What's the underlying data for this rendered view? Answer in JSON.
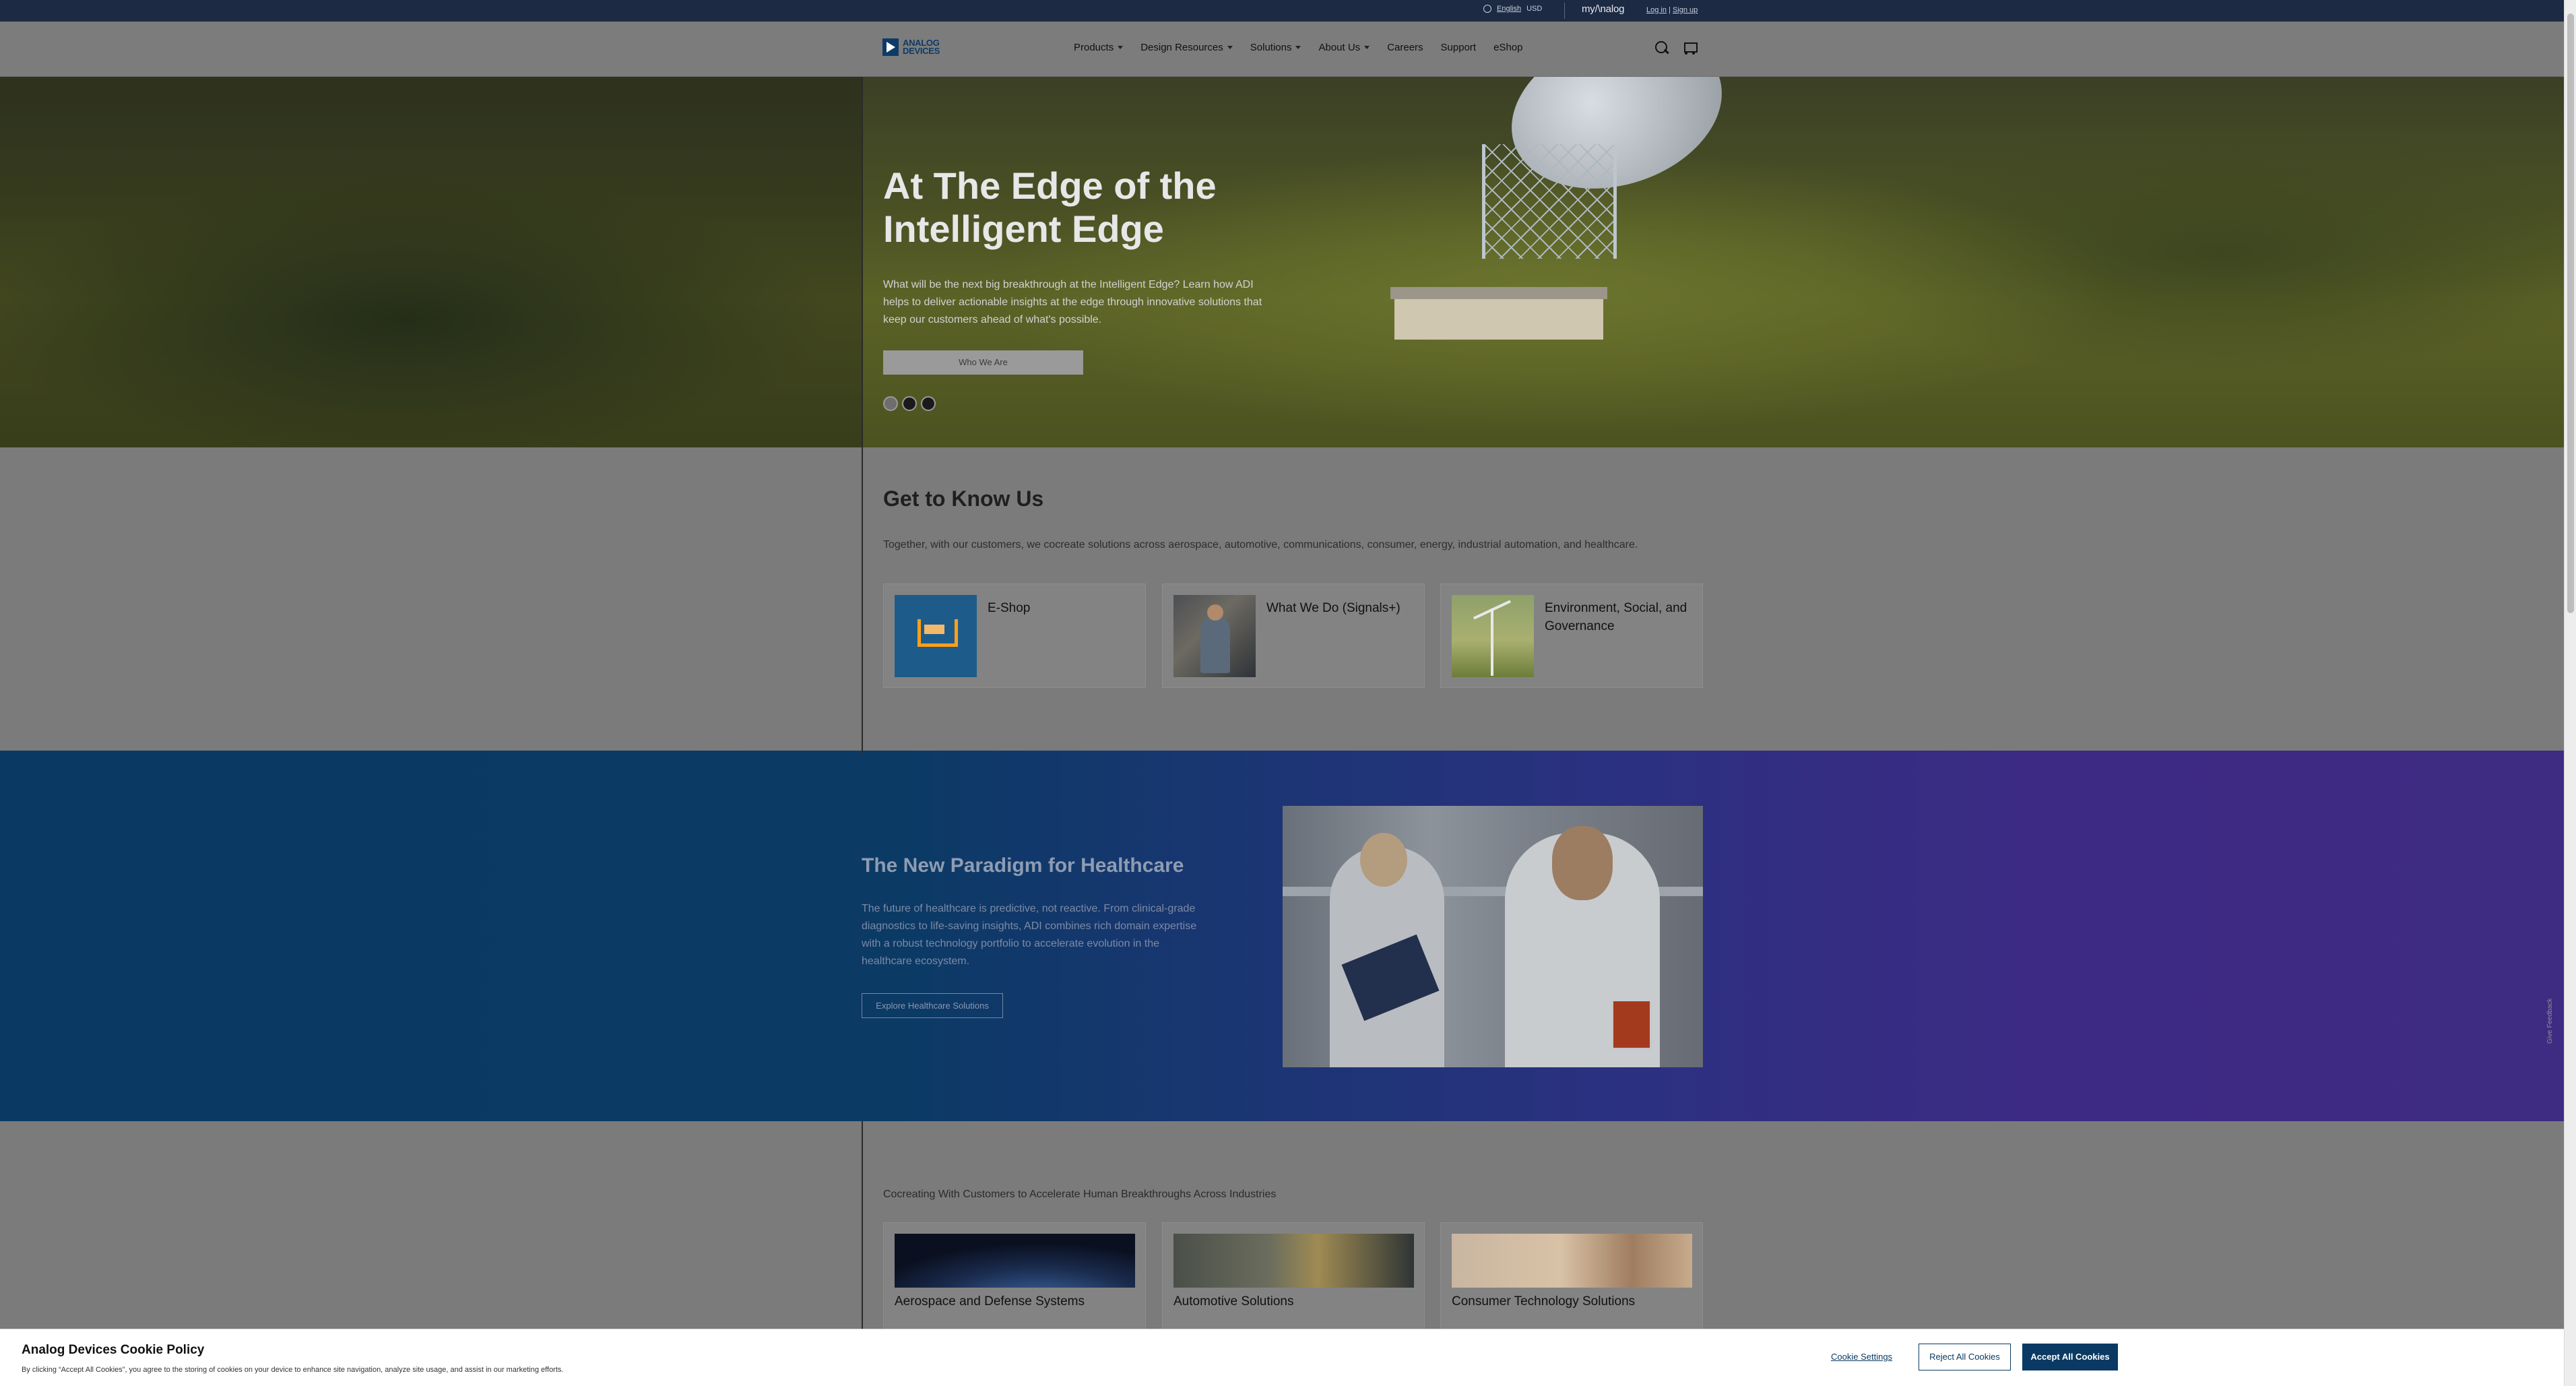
{
  "utility": {
    "language": "English",
    "currency": "USD",
    "myanalog": "my/\\nalog",
    "login": "Log in",
    "separator": "|",
    "signup": "Sign up"
  },
  "nav": {
    "logo_text": "ANALOG DEVICES",
    "items": [
      {
        "label": "Products",
        "dropdown": true
      },
      {
        "label": "Design Resources",
        "dropdown": true
      },
      {
        "label": "Solutions",
        "dropdown": true
      },
      {
        "label": "About Us",
        "dropdown": true
      },
      {
        "label": "Careers",
        "dropdown": false
      },
      {
        "label": "Support",
        "dropdown": false
      },
      {
        "label": "eShop",
        "dropdown": false
      }
    ],
    "icons": [
      "search-icon",
      "cart-icon"
    ]
  },
  "hero": {
    "title": "At The Edge of the Intelligent Edge",
    "description": "What will be the next big breakthrough at the Intelligent Edge? Learn how ADI helps to deliver actionable insights at the edge through innovative solutions that keep our customers ahead of what's possible.",
    "button": "Who We Are",
    "slides": 3,
    "active_slide": 1
  },
  "know_us": {
    "title": "Get to Know Us",
    "description": "Together, with our customers, we cocreate solutions across aerospace, automotive, communications, consumer, energy, industrial automation, and healthcare.",
    "cards": [
      {
        "title": "E-Shop"
      },
      {
        "title": "What We Do (Signals+)"
      },
      {
        "title": "Environment, Social, and Governance"
      }
    ]
  },
  "healthcare": {
    "title": "The New Paradigm for Healthcare",
    "description": "The future of healthcare is predictive, not reactive. From clinical-grade diagnostics to life-saving insights, ADI combines rich domain expertise with a robust technology portfolio to accelerate evolution in the healthcare ecosystem.",
    "button": "Explore Healthcare Solutions"
  },
  "industries": {
    "intro": "Cocreating With Customers to Accelerate Human Breakthroughs Across Industries",
    "cards": [
      {
        "title": "Aerospace and Defense Systems"
      },
      {
        "title": "Automotive Solutions"
      },
      {
        "title": "Consumer Technology Solutions"
      }
    ]
  },
  "feedback": {
    "label": "Give Feedback"
  },
  "cookie": {
    "title": "Analog Devices Cookie Policy",
    "text": "By clicking “Accept All Cookies”, you agree to the storing of cookies on your device to enhance site navigation, analyze site usage, and assist in our marketing efforts.",
    "settings": "Cookie Settings",
    "reject": "Reject All Cookies",
    "accept": "Accept All Cookies"
  },
  "colors": {
    "utility_bar": "#1d2a44",
    "brand_blue": "#0a3a63",
    "healthcare_purple": "#3e2b82"
  }
}
